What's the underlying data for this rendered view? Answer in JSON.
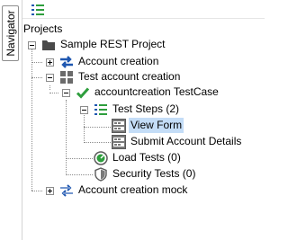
{
  "sidebar": {
    "navigator_tab": "Navigator"
  },
  "header": {
    "title": "Projects"
  },
  "tree": {
    "root": "Sample REST Project",
    "items": [
      {
        "label": "Account creation"
      },
      {
        "label": "Test account creation"
      },
      {
        "label": "accountcreation TestCase"
      },
      {
        "label": "Test Steps (2)"
      },
      {
        "label": "View Form"
      },
      {
        "label": "Submit Account Details"
      },
      {
        "label": "Load Tests (0)"
      },
      {
        "label": "Security Tests (0)"
      },
      {
        "label": "Account creation mock"
      }
    ]
  },
  "colors": {
    "selection": "#c4ddf7",
    "accent_blue": "#1f57b0",
    "accent_green": "#2e9e3d"
  }
}
